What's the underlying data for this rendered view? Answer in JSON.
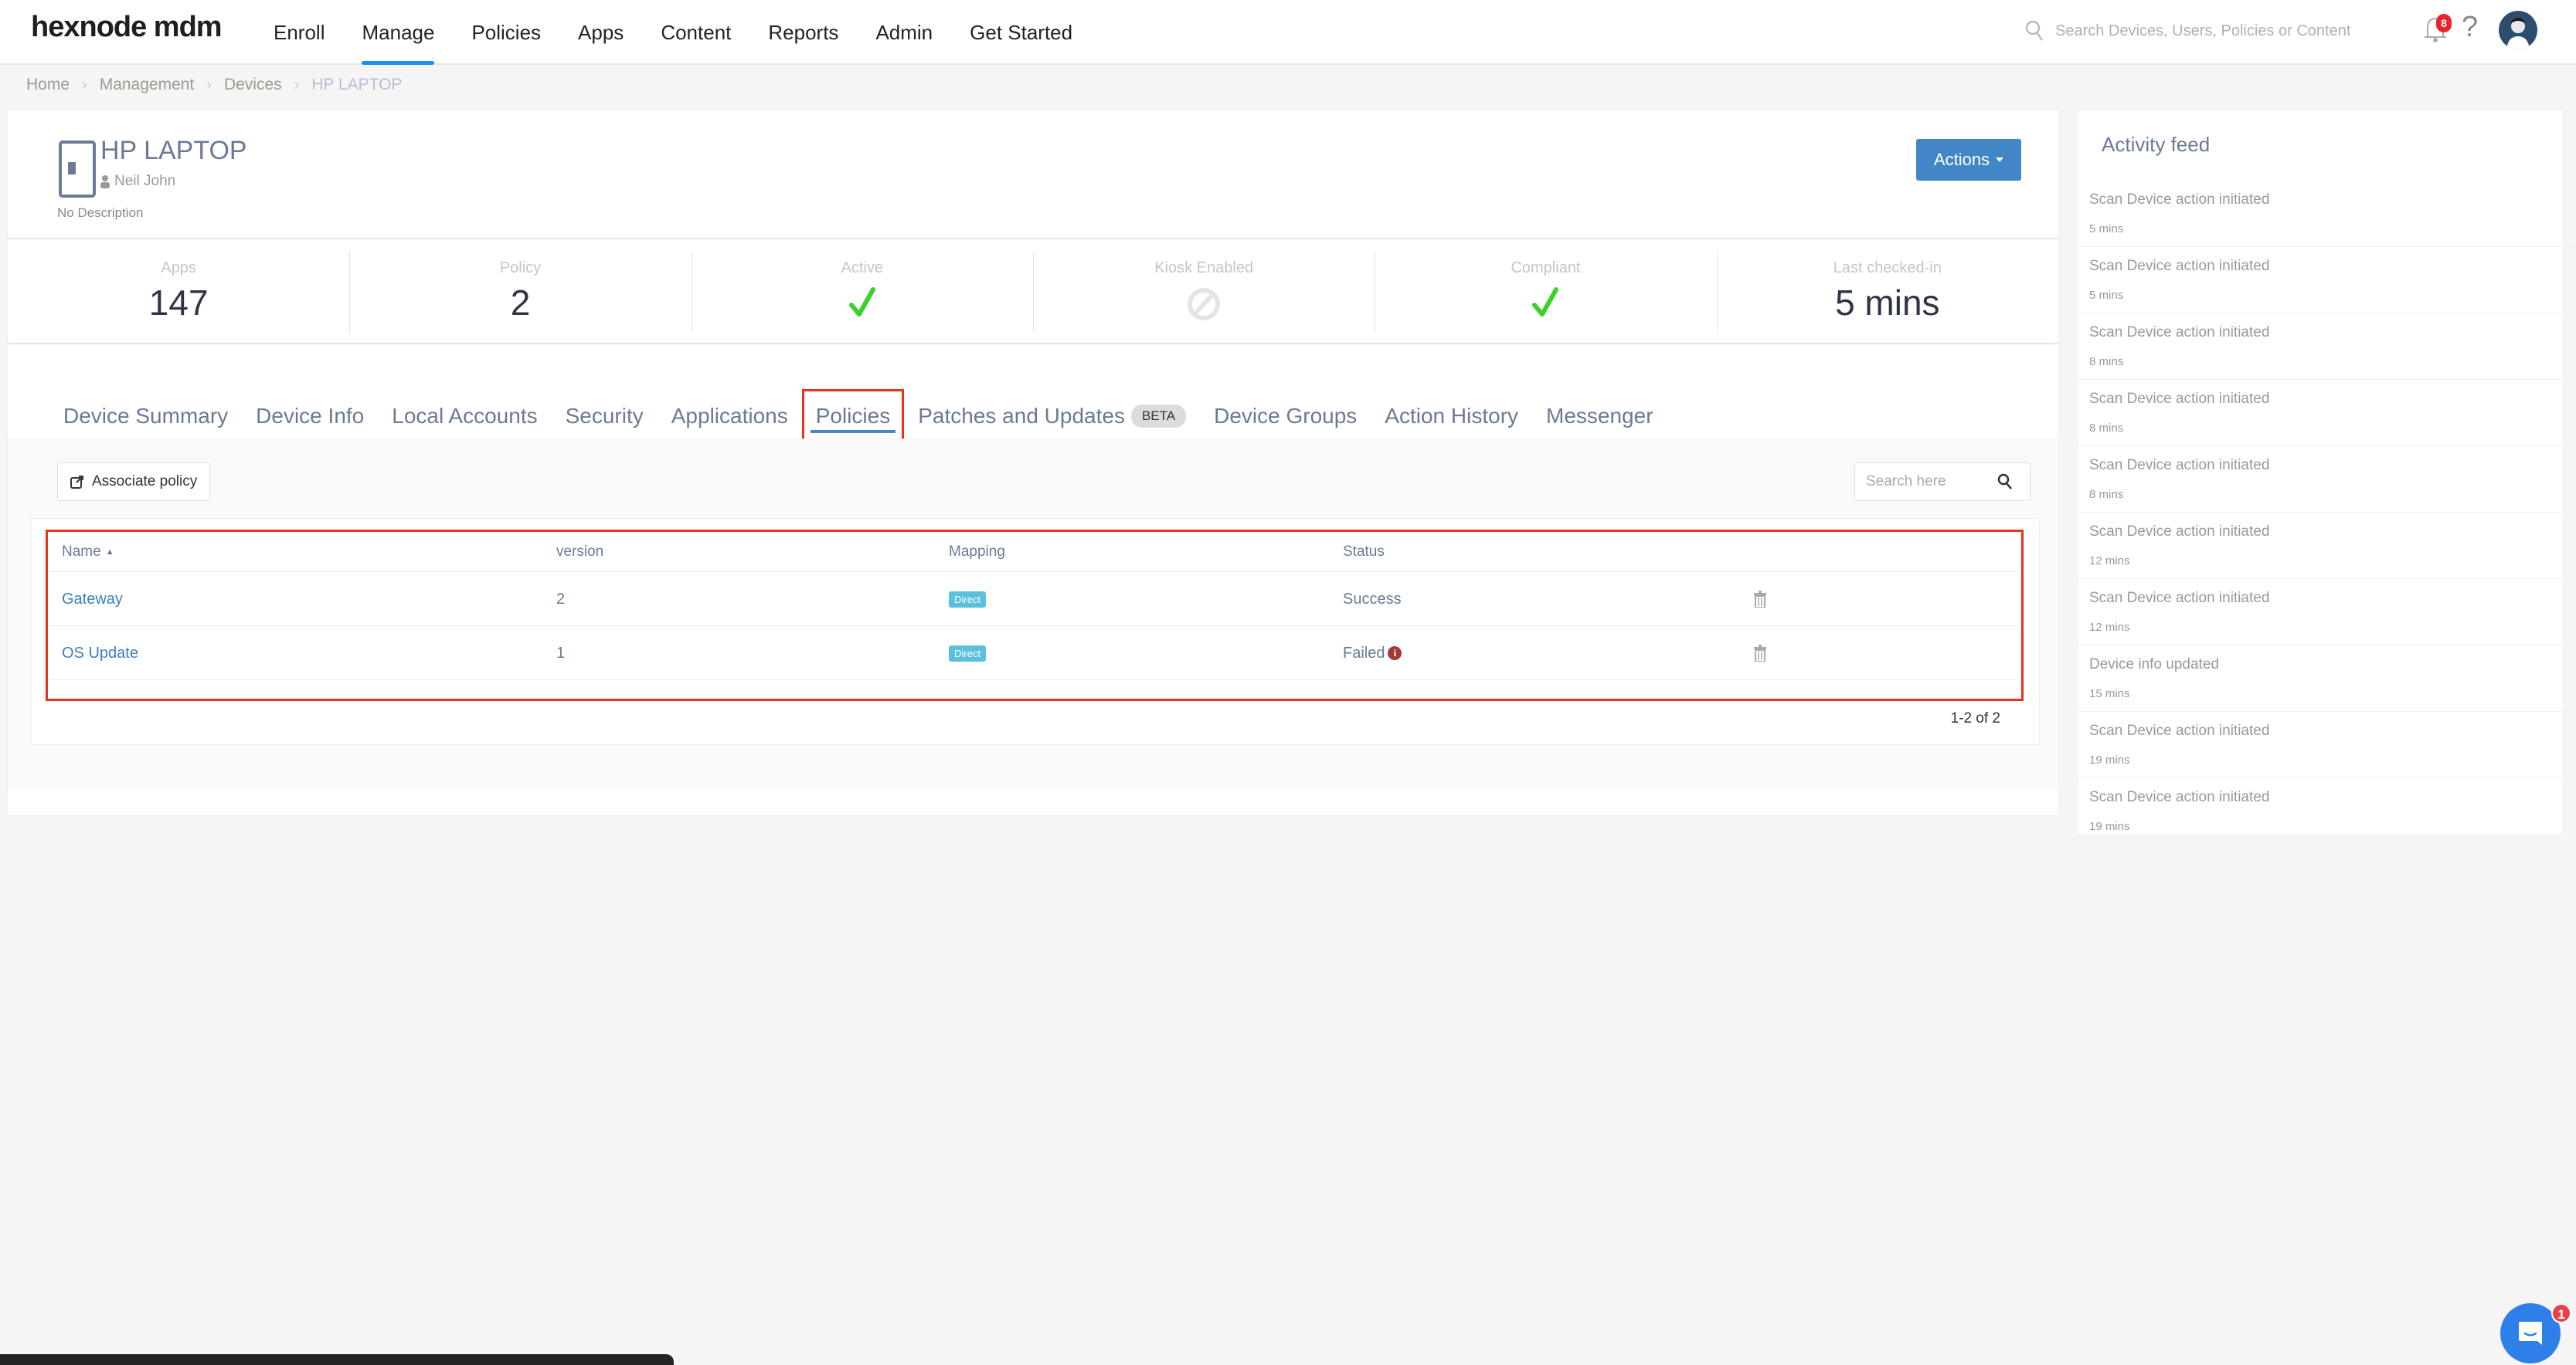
{
  "header": {
    "logo": "hexnode mdm",
    "nav": [
      "Enroll",
      "Manage",
      "Policies",
      "Apps",
      "Content",
      "Reports",
      "Admin",
      "Get Started"
    ],
    "active_nav": "Manage",
    "search_placeholder": "Search Devices, Users, Policies or Content",
    "notification_count": "8",
    "help": "?"
  },
  "breadcrumb": [
    "Home",
    "Management",
    "Devices",
    "HP LAPTOP"
  ],
  "device": {
    "name": "HP LAPTOP",
    "owner": "Neil John",
    "description": "No Description",
    "actions_label": "Actions"
  },
  "stats": [
    {
      "label": "Apps",
      "value": "147"
    },
    {
      "label": "Policy",
      "value": "2"
    },
    {
      "label": "Active",
      "icon": "check-icon",
      "value": "yes"
    },
    {
      "label": "Kiosk Enabled",
      "icon": "disabled-icon",
      "value": "no"
    },
    {
      "label": "Compliant",
      "icon": "check-icon",
      "value": "yes"
    },
    {
      "label": "Last checked-in",
      "value": "5 mins"
    }
  ],
  "tabs": [
    {
      "label": "Device Summary"
    },
    {
      "label": "Device Info"
    },
    {
      "label": "Local Accounts"
    },
    {
      "label": "Security"
    },
    {
      "label": "Applications"
    },
    {
      "label": "Policies",
      "active": true
    },
    {
      "label": "Patches and Updates",
      "badge": "BETA"
    },
    {
      "label": "Device Groups"
    },
    {
      "label": "Action History"
    },
    {
      "label": "Messenger"
    }
  ],
  "policies": {
    "associate_label": "Associate policy",
    "search_placeholder": "Search here",
    "columns": [
      "Name",
      "version",
      "Mapping",
      "Status"
    ],
    "sort_column": "Name",
    "rows": [
      {
        "name": "Gateway",
        "version": "2",
        "mapping": "Direct",
        "status": "Success"
      },
      {
        "name": "OS Update",
        "version": "1",
        "mapping": "Direct",
        "status": "Failed",
        "status_info": "i"
      }
    ],
    "pagination": "1-2 of 2"
  },
  "activity_feed": {
    "title": "Activity feed",
    "items": [
      {
        "message": "Scan Device action initiated",
        "time": "5 mins"
      },
      {
        "message": "Scan Device action initiated",
        "time": "5 mins"
      },
      {
        "message": "Scan Device action initiated",
        "time": "8 mins"
      },
      {
        "message": "Scan Device action initiated",
        "time": "8 mins"
      },
      {
        "message": "Scan Device action initiated",
        "time": "8 mins"
      },
      {
        "message": "Scan Device action initiated",
        "time": "12 mins"
      },
      {
        "message": "Scan Device action initiated",
        "time": "12 mins"
      },
      {
        "message": "Device info updated",
        "time": "15 mins"
      },
      {
        "message": "Scan Device action initiated",
        "time": "19 mins"
      },
      {
        "message": "Scan Device action initiated",
        "time": "19 mins"
      }
    ]
  },
  "chat": {
    "badge": "1"
  },
  "colors": {
    "accent": "#1a8ff5",
    "primary_button": "#4286c8",
    "highlight_box": "#e8321f",
    "success_check": "#3bd12a",
    "direct_badge": "#5bc0de",
    "failed_info": "#a33a3a"
  }
}
